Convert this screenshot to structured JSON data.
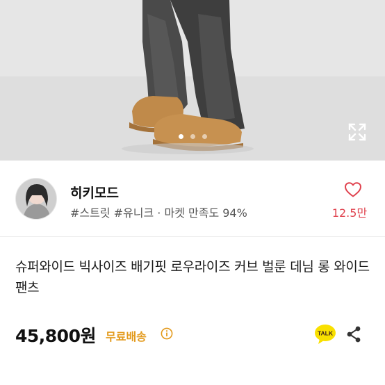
{
  "gallery": {
    "dot_count": 3,
    "active_dot": 0,
    "expand_icon": "expand-icon"
  },
  "seller": {
    "name": "히키모드",
    "tags_line": "#스트릿 #유니크 · 마켓 만족도 94%",
    "avatar_icon": "avatar",
    "like_icon": "heart-icon",
    "like_count": "12.5만"
  },
  "product": {
    "title": "슈퍼와이드 빅사이즈 배기핏 로우라이즈 커브 벌룬 데님 롱 와이드팬츠",
    "price": "45,800원",
    "shipping_label": "무료배송",
    "info_icon": "info-icon",
    "talk_icon": "kakaotalk-icon",
    "talk_label": "TALK",
    "share_icon": "share-icon"
  },
  "colors": {
    "accent_red": "#e0434f",
    "shipping_orange": "#e39a1c",
    "talk_yellow": "#f9e000"
  }
}
